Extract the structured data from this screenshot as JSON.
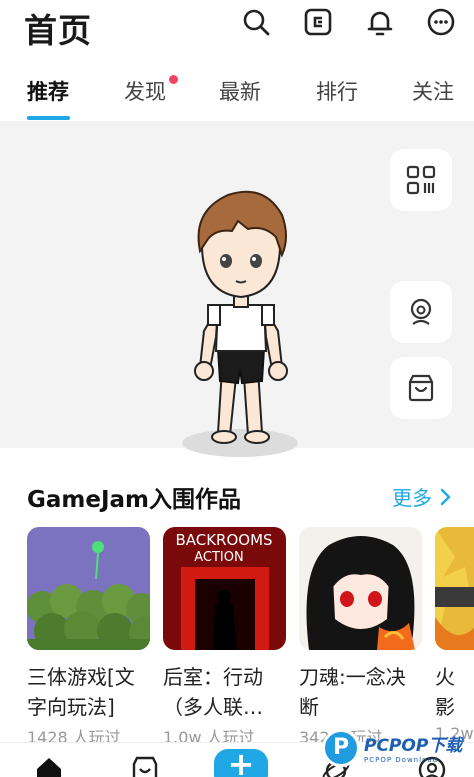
{
  "header": {
    "title": "首页",
    "icons": [
      "search-icon",
      "coupon-icon",
      "bell-icon",
      "chat-icon"
    ]
  },
  "tabs": [
    {
      "label": "推荐",
      "active": true
    },
    {
      "label": "发现",
      "badge": true
    },
    {
      "label": "最新"
    },
    {
      "label": "排行"
    },
    {
      "label": "关注"
    }
  ],
  "stage": {
    "side_buttons": [
      "qr-scan-icon",
      "avatar-icon",
      "shop-bag-icon"
    ]
  },
  "section": {
    "title": "GameJam入围作品",
    "more": "更多"
  },
  "games": [
    {
      "title": "三体游戏[文字向玩法]",
      "plays": "1428 人玩过"
    },
    {
      "title": "后室：行动（多人联…",
      "plays": "1.0w 人玩过"
    },
    {
      "title": "刀魂:一念决断",
      "plays": "342 人玩过"
    },
    {
      "title": "火影巅峰",
      "plays": "1.2w"
    }
  ],
  "thumb_text": {
    "backrooms": "BACKROOMS",
    "action": "ACTION"
  },
  "bottom_nav": {
    "add_label": "+"
  },
  "watermark": {
    "main": "PCPOP下载",
    "sub": "PCPOP Download"
  },
  "colors": {
    "accent": "#20a8e6",
    "badge": "#f04462"
  }
}
